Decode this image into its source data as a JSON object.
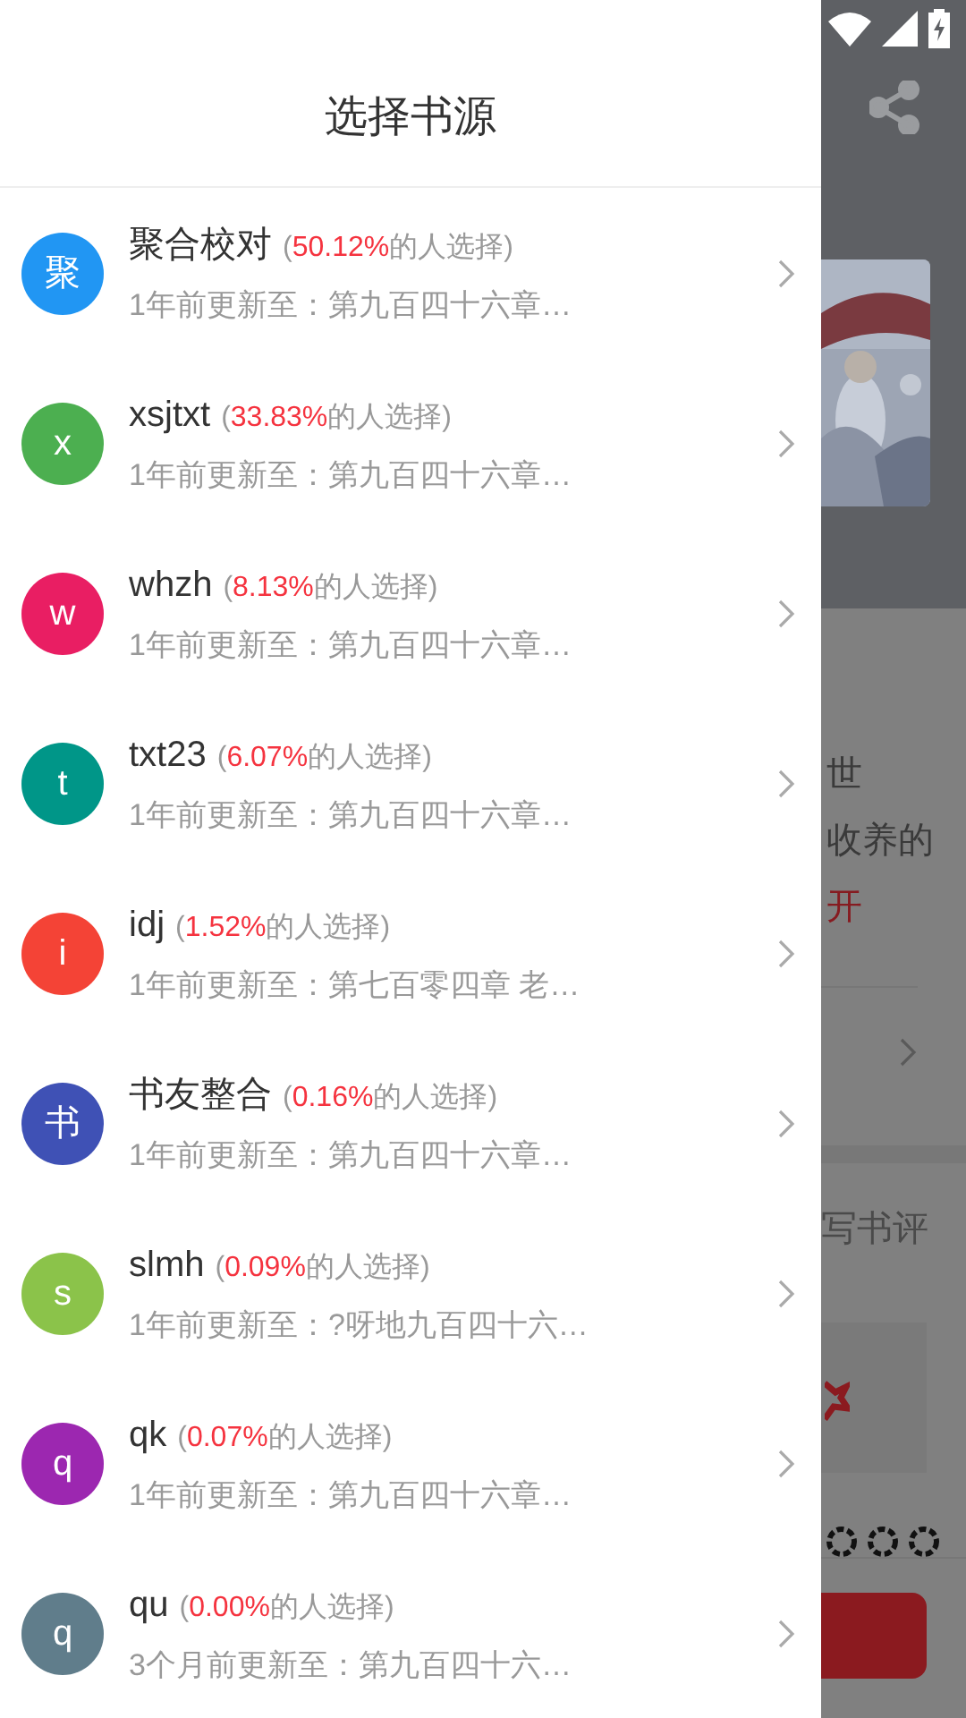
{
  "drawer": {
    "title": "选择书源"
  },
  "sources": [
    {
      "avatar": "聚",
      "color": "#2196f3",
      "name": "聚合校对",
      "before": "(",
      "percent": "50.12%",
      "after": "的人选择)",
      "update": "1年前更新至：第九百四十六章…"
    },
    {
      "avatar": "x",
      "color": "#4caf50",
      "name": "xsjtxt",
      "before": "(",
      "percent": "33.83%",
      "after": "的人选择)",
      "update": "1年前更新至：第九百四十六章…"
    },
    {
      "avatar": "w",
      "color": "#e91e63",
      "name": "whzh",
      "before": "(",
      "percent": "8.13%",
      "after": "的人选择)",
      "update": "1年前更新至：第九百四十六章…"
    },
    {
      "avatar": "t",
      "color": "#009688",
      "name": "txt23",
      "before": "(",
      "percent": "6.07%",
      "after": "的人选择)",
      "update": "1年前更新至：第九百四十六章…"
    },
    {
      "avatar": "i",
      "color": "#f44336",
      "name": "idj",
      "before": "(",
      "percent": "1.52%",
      "after": "的人选择)",
      "update": "1年前更新至：第七百零四章 老…"
    },
    {
      "avatar": "书",
      "color": "#3f51b5",
      "name": "书友整合",
      "before": "(",
      "percent": "0.16%",
      "after": "的人选择)",
      "update": "1年前更新至：第九百四十六章…"
    },
    {
      "avatar": "s",
      "color": "#8bc34a",
      "name": "slmh",
      "before": "(",
      "percent": "0.09%",
      "after": "的人选择)",
      "update": "1年前更新至：?呀地九百四十六…"
    },
    {
      "avatar": "q",
      "color": "#9c27b0",
      "name": "qk",
      "before": "(",
      "percent": "0.07%",
      "after": "的人选择)",
      "update": "1年前更新至：第九百四十六章…"
    },
    {
      "avatar": "q",
      "color": "#607d8b",
      "name": "qu",
      "before": "(",
      "percent": "0.00%",
      "after": "的人选择)",
      "update": "3个月前更新至：第九百四十六…"
    }
  ],
  "background_page": {
    "intro_lines": [
      "世",
      "收养的"
    ],
    "expand_link": "开",
    "review_link": "写书评"
  }
}
